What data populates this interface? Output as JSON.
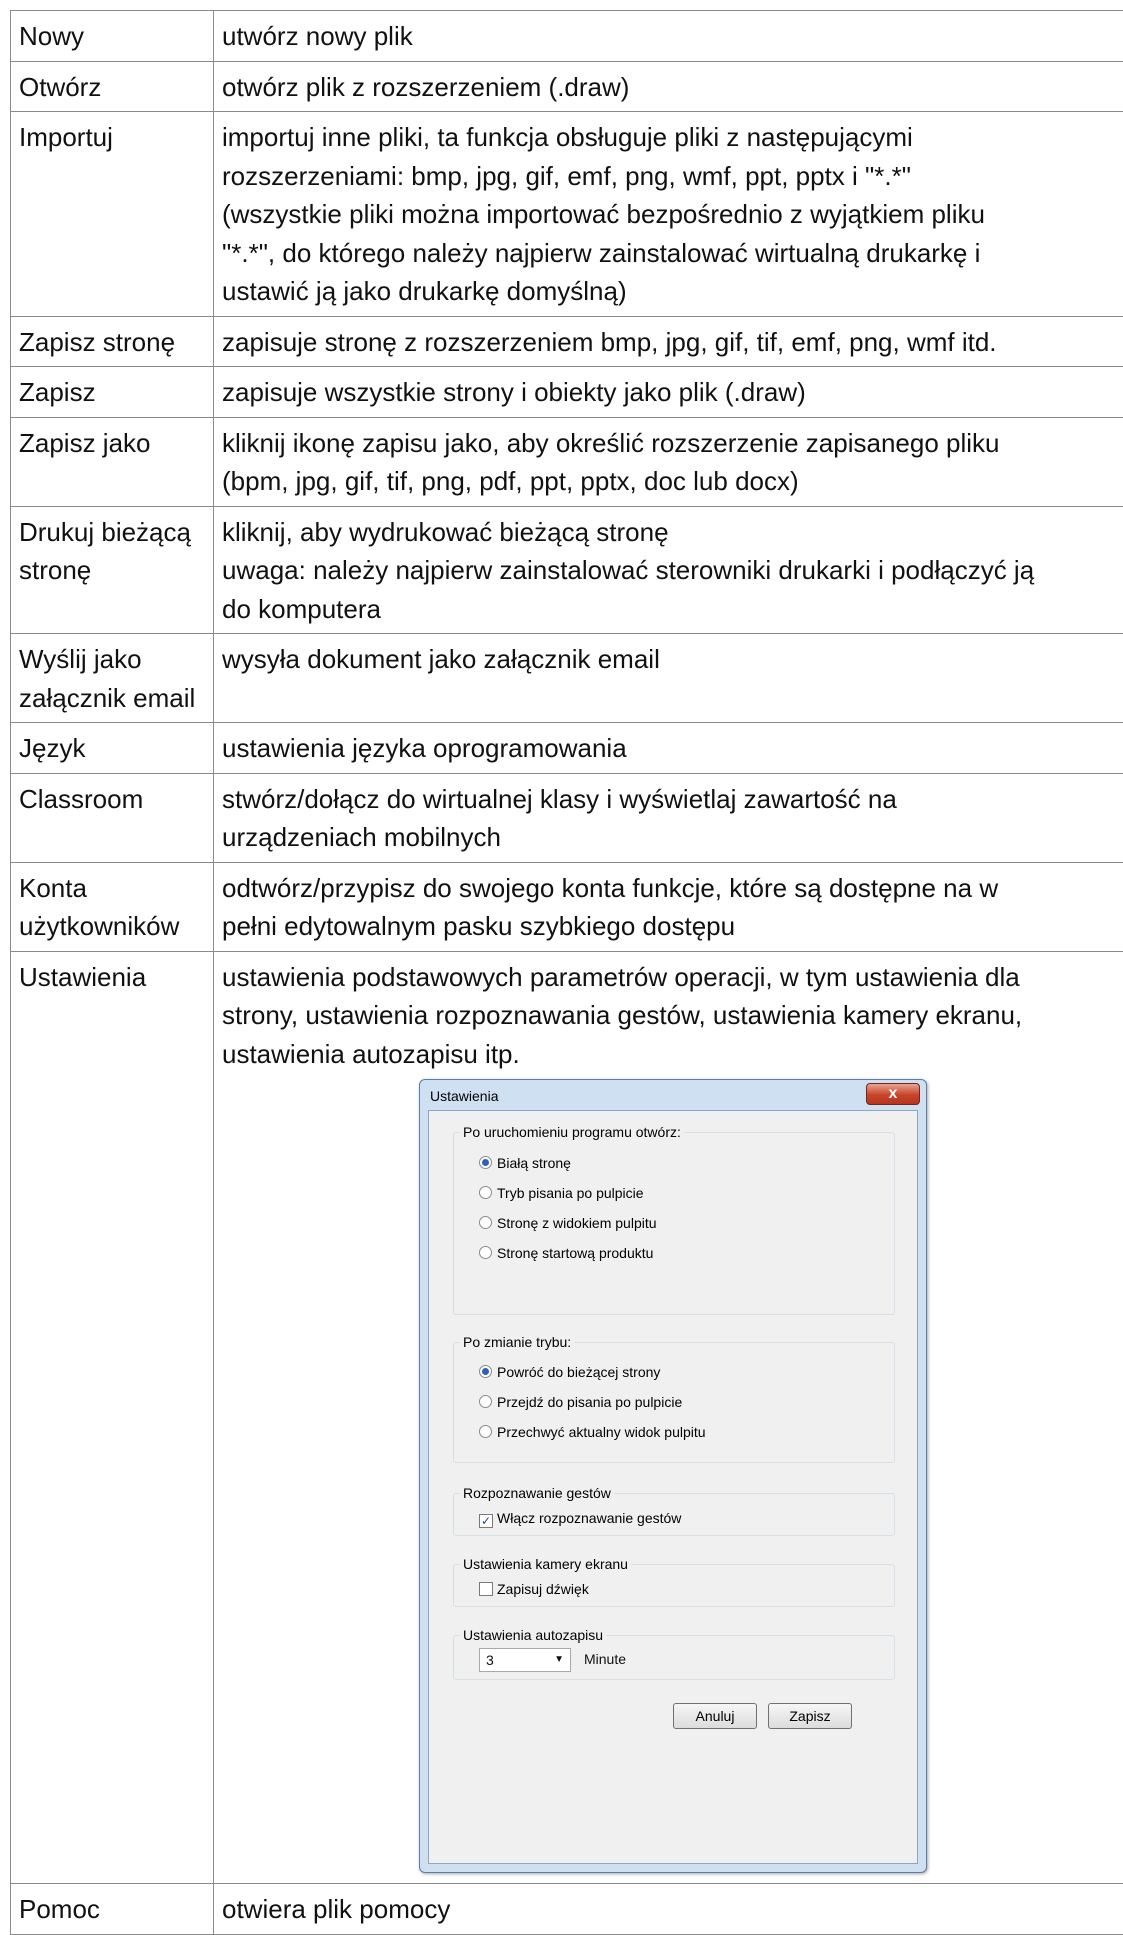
{
  "rows": [
    {
      "name": [
        "Nowy"
      ],
      "desc": [
        "utwórz nowy plik"
      ]
    },
    {
      "name": [
        "Otwórz"
      ],
      "desc": [
        "otwórz plik z rozszerzeniem (.draw)"
      ]
    },
    {
      "name": [
        "Importuj"
      ],
      "desc": [
        "importuj inne pliki, ta funkcja obsługuje pliki z następującymi",
        "rozszerzeniami: bmp, jpg, gif, emf, png, wmf, ppt, pptx i \"*.*\"",
        "(wszystkie pliki można importować bezpośrednio z wyjątkiem pliku",
        "\"*.*\", do którego należy najpierw zainstalować wirtualną drukarkę i",
        "ustawić ją jako drukarkę domyślną)"
      ]
    },
    {
      "name": [
        "Zapisz stronę"
      ],
      "desc": [
        "zapisuje stronę z rozszerzeniem bmp, jpg, gif, tif, emf, png, wmf itd."
      ]
    },
    {
      "name": [
        "Zapisz"
      ],
      "desc": [
        "zapisuje wszystkie strony i obiekty jako plik (.draw)"
      ]
    },
    {
      "name": [
        "Zapisz jako"
      ],
      "desc": [
        "kliknij ikonę zapisu jako, aby określić rozszerzenie zapisanego pliku",
        "(bpm, jpg, gif, tif, png, pdf, ppt, pptx, doc lub docx)"
      ]
    },
    {
      "name": [
        "Drukuj bieżącą",
        "stronę"
      ],
      "desc": [
        "kliknij, aby wydrukować bieżącą stronę",
        "uwaga: należy najpierw zainstalować sterowniki drukarki i podłączyć ją",
        "do komputera"
      ]
    },
    {
      "name": [
        "Wyślij jako",
        "załącznik email"
      ],
      "desc": [
        "wysyła dokument jako załącznik email"
      ]
    },
    {
      "name": [
        "Język"
      ],
      "desc": [
        "ustawienia języka oprogramowania"
      ]
    },
    {
      "name": [
        "Classroom"
      ],
      "desc": [
        "stwórz/dołącz do wirtualnej klasy i wyświetlaj zawartość na",
        "urządzeniach mobilnych"
      ]
    },
    {
      "name": [
        "Konta",
        "użytkowników"
      ],
      "desc": [
        "odtwórz/przypisz do swojego konta funkcje, które są dostępne na w",
        "pełni edytowalnym pasku szybkiego dostępu"
      ]
    },
    {
      "name": [
        "Ustawienia"
      ],
      "desc": [
        "ustawienia podstawowych parametrów operacji, w tym ustawienia dla",
        "strony, ustawienia rozpoznawania gestów, ustawienia kamery ekranu,",
        "ustawienia autozapisu itp."
      ]
    },
    {
      "name": [
        "Pomoc"
      ],
      "desc": [
        "otwiera plik pomocy"
      ]
    }
  ],
  "dialog": {
    "title": "Ustawienia",
    "close_glyph": "x",
    "startup": {
      "legend": "Po uruchomieniu programu otwórz:",
      "options": [
        "Białą stronę",
        "Tryb pisania po pulpicie",
        "Stronę z widokiem pulpitu",
        "Stronę startową produktu"
      ],
      "selected": 0
    },
    "mode_change": {
      "legend": "Po zmianie trybu:",
      "options": [
        "Powróć do bieżącej strony",
        "Przejdź do pisania po pulpicie",
        "Przechwyć aktualny widok pulpitu"
      ],
      "selected": 0
    },
    "gestures": {
      "legend": "Rozpoznawanie gestów",
      "checkbox": "Włącz rozpoznawanie gestów",
      "checked": true
    },
    "camera": {
      "legend": "Ustawienia kamery ekranu",
      "checkbox": "Zapisuj dźwięk",
      "checked": false
    },
    "autosave": {
      "legend": "Ustawienia autozapisu",
      "value": "3",
      "unit": "Minute"
    },
    "cancel_label": "Anuluj",
    "save_label": "Zapisz"
  }
}
